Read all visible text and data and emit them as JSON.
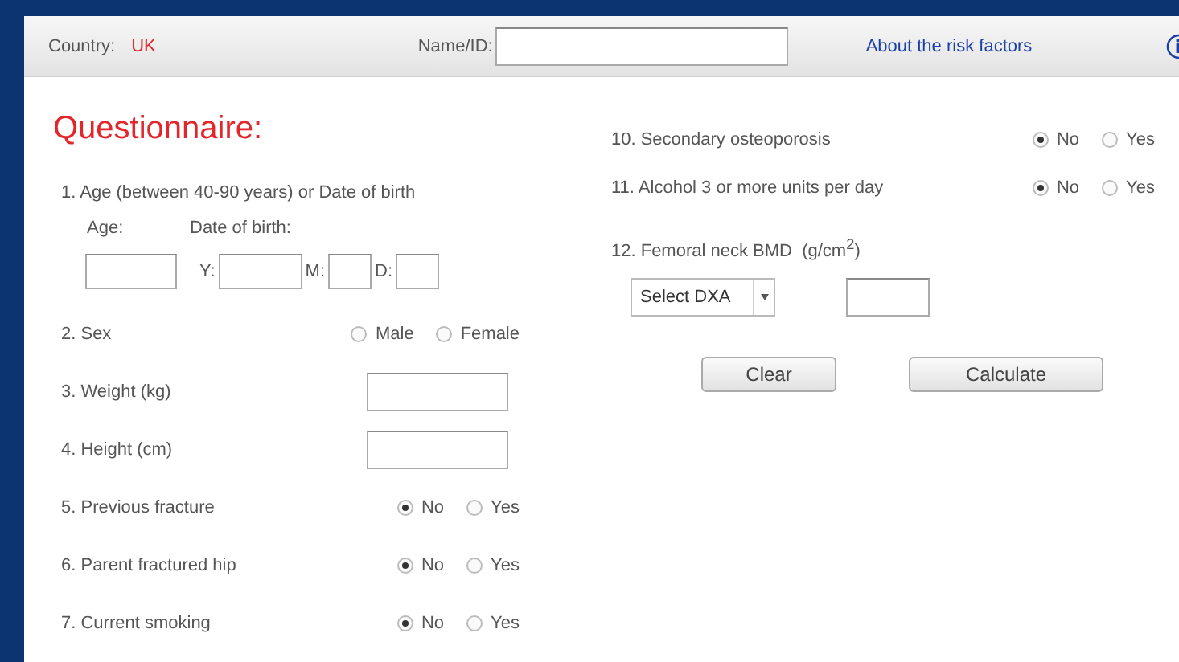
{
  "header": {
    "country_label": "Country:",
    "country_value": "UK",
    "name_label": "Name/ID:",
    "link": "About the risk factors"
  },
  "title": "Questionnaire:",
  "left": [
    {
      "kind": "date",
      "label": "1. Age (between 40-90 years) or Date of birth",
      "age_label": "Age:",
      "dob_label": "Date of birth:",
      "year_label": "Y:",
      "month_label": "M:",
      "day_label": "D:"
    },
    {
      "kind": "radio",
      "label": "2. Sex",
      "options": [
        {
          "label": "Male",
          "selected": false
        },
        {
          "label": "Female",
          "selected": false
        }
      ]
    },
    {
      "kind": "input",
      "label": "3. Weight (kg)"
    },
    {
      "kind": "input",
      "label": "4. Height (cm)"
    },
    {
      "kind": "radio",
      "label": "5. Previous fracture",
      "options": [
        {
          "label": "No",
          "selected": true
        },
        {
          "label": "Yes",
          "selected": false
        }
      ]
    },
    {
      "kind": "radio",
      "label": "6. Parent fractured hip",
      "options": [
        {
          "label": "No",
          "selected": true
        },
        {
          "label": "Yes",
          "selected": false
        }
      ]
    },
    {
      "kind": "radio",
      "label": "7. Current smoking",
      "options": [
        {
          "label": "No",
          "selected": true
        },
        {
          "label": "Yes",
          "selected": false
        }
      ]
    }
  ],
  "right": [
    {
      "kind": "radio",
      "label": "10. Secondary osteoporosis",
      "options": [
        {
          "label": "No",
          "selected": true
        },
        {
          "label": "Yes",
          "selected": false
        }
      ]
    },
    {
      "kind": "radio",
      "label": "11. Alcohol 3 or more units per day",
      "options": [
        {
          "label": "No",
          "selected": true
        },
        {
          "label": "Yes",
          "selected": false
        }
      ]
    },
    {
      "kind": "bmd",
      "label": "12. Femoral neck BMD  (g/cm$^{2}$)",
      "select": "Select DXA"
    }
  ],
  "buttons": [
    "Clear",
    "Calculate"
  ]
}
